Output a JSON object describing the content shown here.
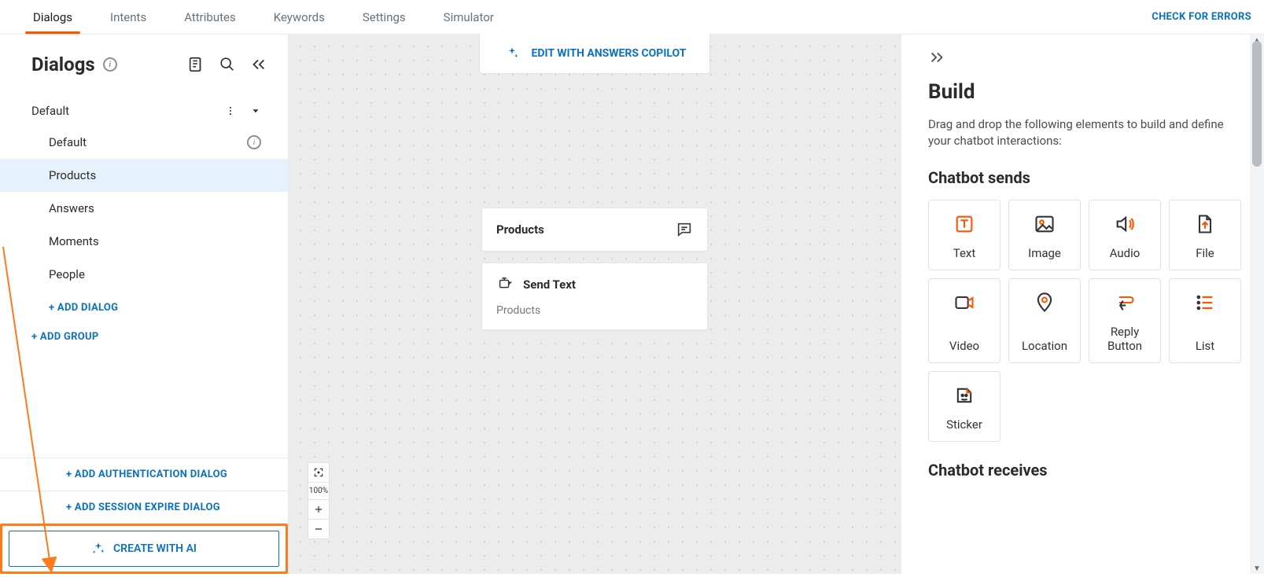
{
  "topbar": {
    "tabs": [
      "Dialogs",
      "Intents",
      "Attributes",
      "Keywords",
      "Settings",
      "Simulator"
    ],
    "active_index": 0,
    "check_errors": "CHECK FOR ERRORS"
  },
  "sidebar": {
    "title": "Dialogs",
    "group_name": "Default",
    "items": [
      "Default",
      "Products",
      "Answers",
      "Moments",
      "People"
    ],
    "selected_index": 1,
    "add_dialog": "+ ADD DIALOG",
    "add_group": "+ ADD GROUP",
    "add_auth": "+ ADD AUTHENTICATION DIALOG",
    "add_session": "+ ADD SESSION EXPIRE DIALOG",
    "create_ai": "CREATE WITH AI"
  },
  "canvas": {
    "edit_pill": "EDIT WITH ANSWERS COPILOT",
    "node_header": "Products",
    "node_title": "Send Text",
    "node_subtitle": "Products",
    "zoom_level": "100%"
  },
  "inspector": {
    "title": "Build",
    "description": "Drag and drop the following elements to build and define your chatbot interactions:",
    "section_sends": "Chatbot sends",
    "section_receives": "Chatbot receives",
    "send_tiles": [
      "Text",
      "Image",
      "Audio",
      "File",
      "Video",
      "Location",
      "Reply Button",
      "List",
      "Sticker"
    ]
  }
}
